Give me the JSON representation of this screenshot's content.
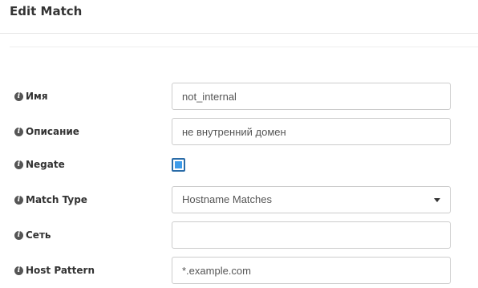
{
  "dialog": {
    "title": "Edit Match"
  },
  "form": {
    "name": {
      "label": "Имя",
      "value": "not_internal"
    },
    "description": {
      "label": "Описание",
      "value": "не внутренний домен"
    },
    "negate": {
      "label": "Negate",
      "checked": true
    },
    "match_type": {
      "label": "Match Type",
      "selected": "Hostname Matches"
    },
    "network": {
      "label": "Сеть",
      "value": ""
    },
    "host_pattern": {
      "label": "Host Pattern",
      "value": "*.example.com"
    }
  },
  "icons": {
    "info": "info-circle-icon",
    "dropdown": "caret-down-icon"
  },
  "colors": {
    "checkbox_border": "#2a6ca8",
    "checkbox_fill": "#3d9be9",
    "input_border": "#cccccc"
  }
}
